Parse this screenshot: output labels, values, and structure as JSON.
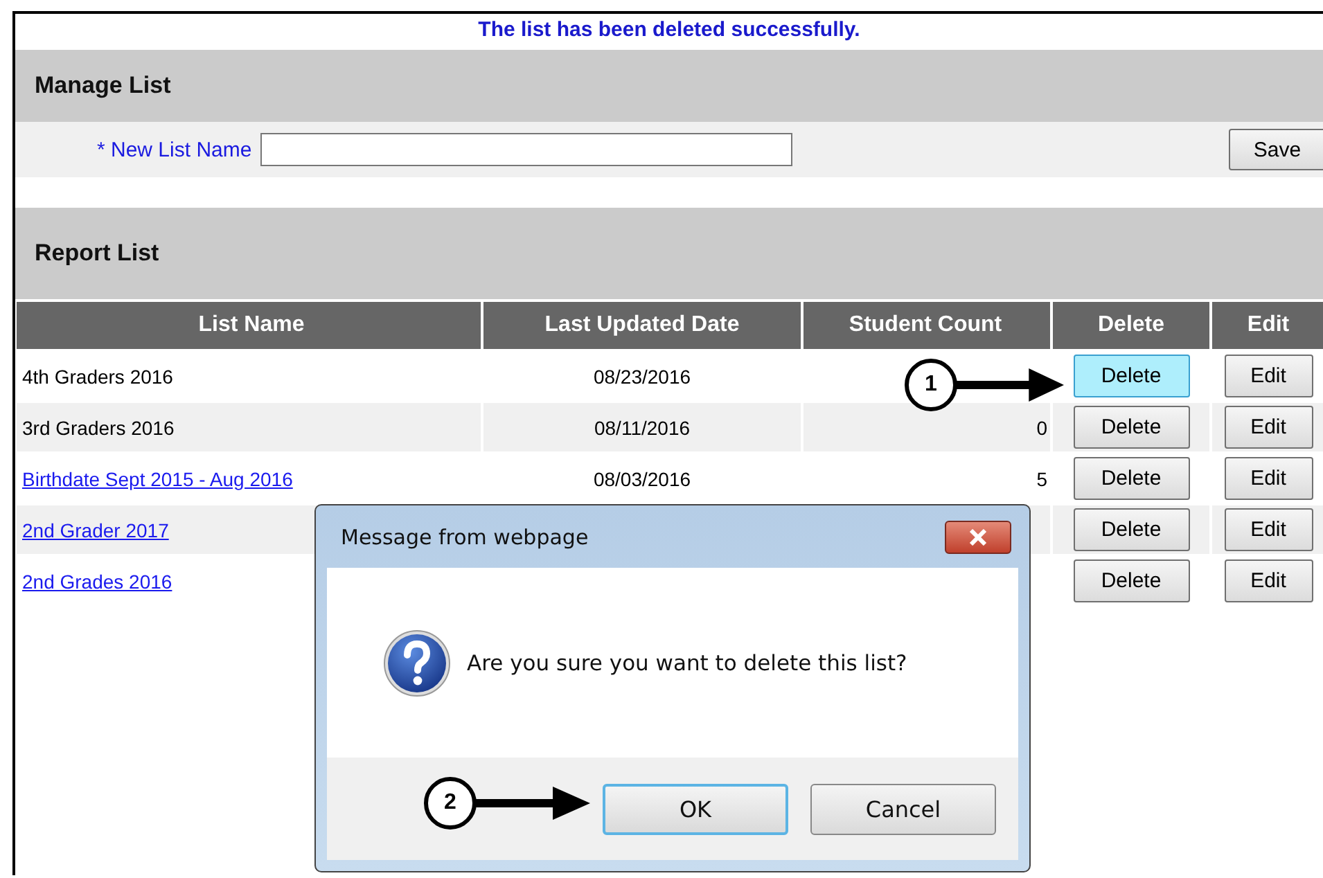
{
  "message": "The list has been deleted successfully.",
  "manage_list": {
    "title": "Manage List",
    "field_label": "* New List Name",
    "save": "Save"
  },
  "report_list": {
    "title": "Report List",
    "columns": [
      "List Name",
      "Last Updated Date",
      "Student Count",
      "Delete",
      "Edit"
    ],
    "rows": [
      {
        "list_name": "4th Graders 2016",
        "link": false,
        "date": "08/23/2016",
        "delete": "Delete",
        "delete_highlighted": true,
        "edit": "Edit"
      },
      {
        "list_name": "3rd Graders 2016",
        "link": false,
        "date": "08/11/2016",
        "count": "0",
        "delete": "Delete",
        "delete_highlighted": false,
        "edit": "Edit"
      },
      {
        "list_name": "Birthdate Sept 2015 - Aug 2016",
        "link": true,
        "date": "08/03/2016",
        "count": "5",
        "delete": "Delete",
        "delete_highlighted": false,
        "edit": "Edit"
      },
      {
        "list_name": "2nd Grader 2017",
        "link": true,
        "delete": "Delete",
        "delete_highlighted": false,
        "edit": "Edit"
      },
      {
        "list_name": "2nd Grades 2016",
        "link": true,
        "delete": "Delete",
        "delete_highlighted": false,
        "edit": "Edit"
      }
    ]
  },
  "dialog": {
    "title": "Message from webpage",
    "text": "Are you sure you want to delete this list?",
    "buttons": [
      {
        "label": "OK",
        "focused": true
      },
      {
        "label": "Cancel",
        "focused": false
      }
    ]
  },
  "callouts": [
    {
      "number": "1"
    },
    {
      "number": "2"
    }
  ]
}
